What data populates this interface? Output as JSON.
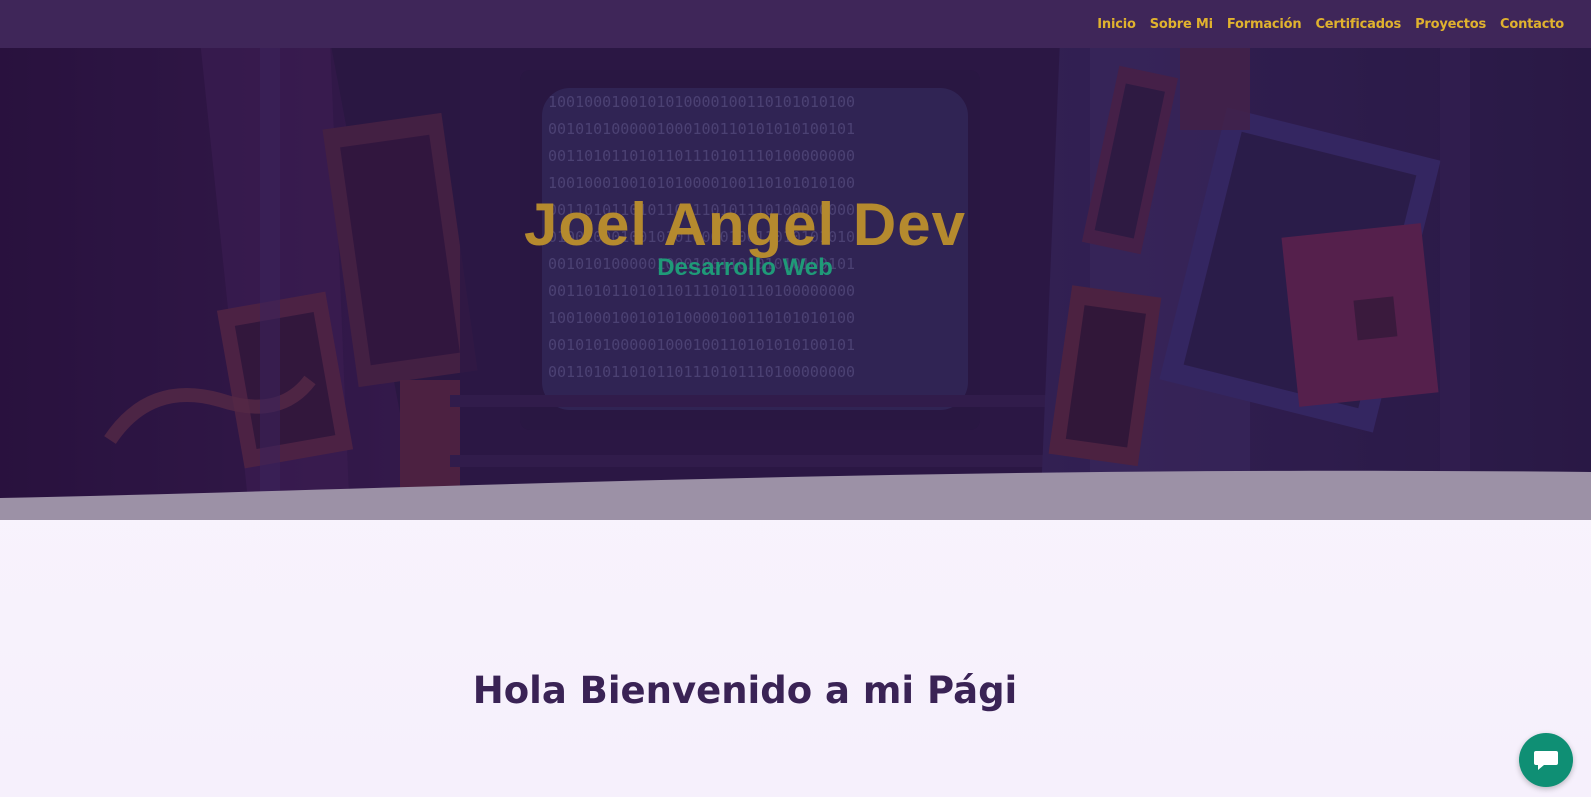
{
  "nav": {
    "items": [
      {
        "label": "Inicio"
      },
      {
        "label": "Sobre Mi"
      },
      {
        "label": "Formación"
      },
      {
        "label": "Certificados"
      },
      {
        "label": "Proyectos"
      },
      {
        "label": "Contacto"
      }
    ]
  },
  "hero": {
    "title": "Joel Angel Dev",
    "subtitle": "Desarrollo Web",
    "binary_rows": [
      "1001000100101010000100110101010100",
      "0010101000001000100110101010100101",
      "0011010110101101110101110100000000",
      "1001000100101010000100110101010100",
      "0011010110101101110101110100000000",
      "0100100010010101000010011010101010",
      "0010101000001000100110101010100101",
      "0011010110101101110101110100000000",
      "1001000100101010000100110101010100",
      "0010101000001000100110101010100101",
      "0011010110101101110101110100000000"
    ]
  },
  "main": {
    "welcome": "Hola Bienvenido a mi Pági"
  },
  "chat": {
    "icon": "chat-bubble-icon"
  },
  "colors": {
    "nav_bg": "#3f2659",
    "nav_text": "#e0b22e",
    "title": "#b58a2e",
    "subtitle": "#1f9a78",
    "welcome": "#3a2355",
    "chat_button": "#0f8f74"
  }
}
